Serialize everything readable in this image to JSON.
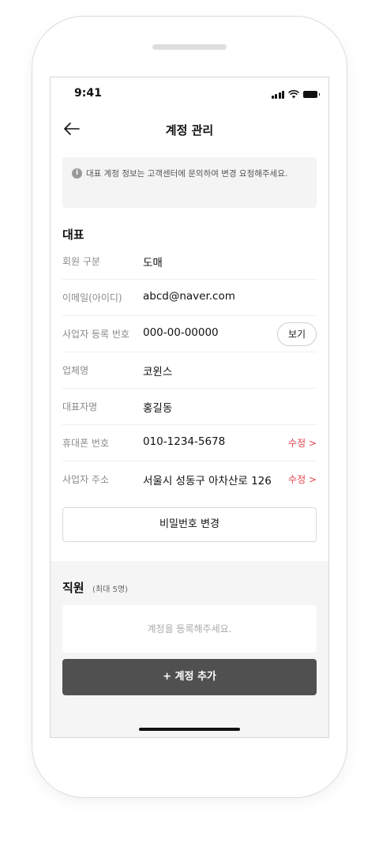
{
  "status_bar": {
    "time": "9:41"
  },
  "header": {
    "title": "계정 관리"
  },
  "notice": {
    "text": "대표 계정 정보는 고객센터에 문의하여 변경 요청해주세요."
  },
  "representative": {
    "section_title": "대표",
    "rows": [
      {
        "label": "회원 구분",
        "value": "도매"
      },
      {
        "label": "이메일(아이디)",
        "value": "abcd@naver.com"
      },
      {
        "label": "사업자 등록 번호",
        "value": "000-00-00000",
        "action": "보기"
      },
      {
        "label": "업체명",
        "value": "코윈스"
      },
      {
        "label": "대표자명",
        "value": "홍길동"
      },
      {
        "label": "휴대폰 번호",
        "value": "010-1234-5678",
        "action": "수정 >"
      },
      {
        "label": "사업자 주소",
        "value": "서울시 성동구 아차산로 126",
        "action": "수정 >"
      }
    ],
    "password_button": "비밀번호 변경"
  },
  "staff": {
    "title": "직원",
    "subtitle": "(최대 5명)",
    "empty_text": "계정을 등록해주세요.",
    "add_button": "+  계정 추가"
  },
  "colors": {
    "accent_red": "#e8434f",
    "dark_button": "#505050",
    "gray_bg": "#f5f5f5"
  }
}
